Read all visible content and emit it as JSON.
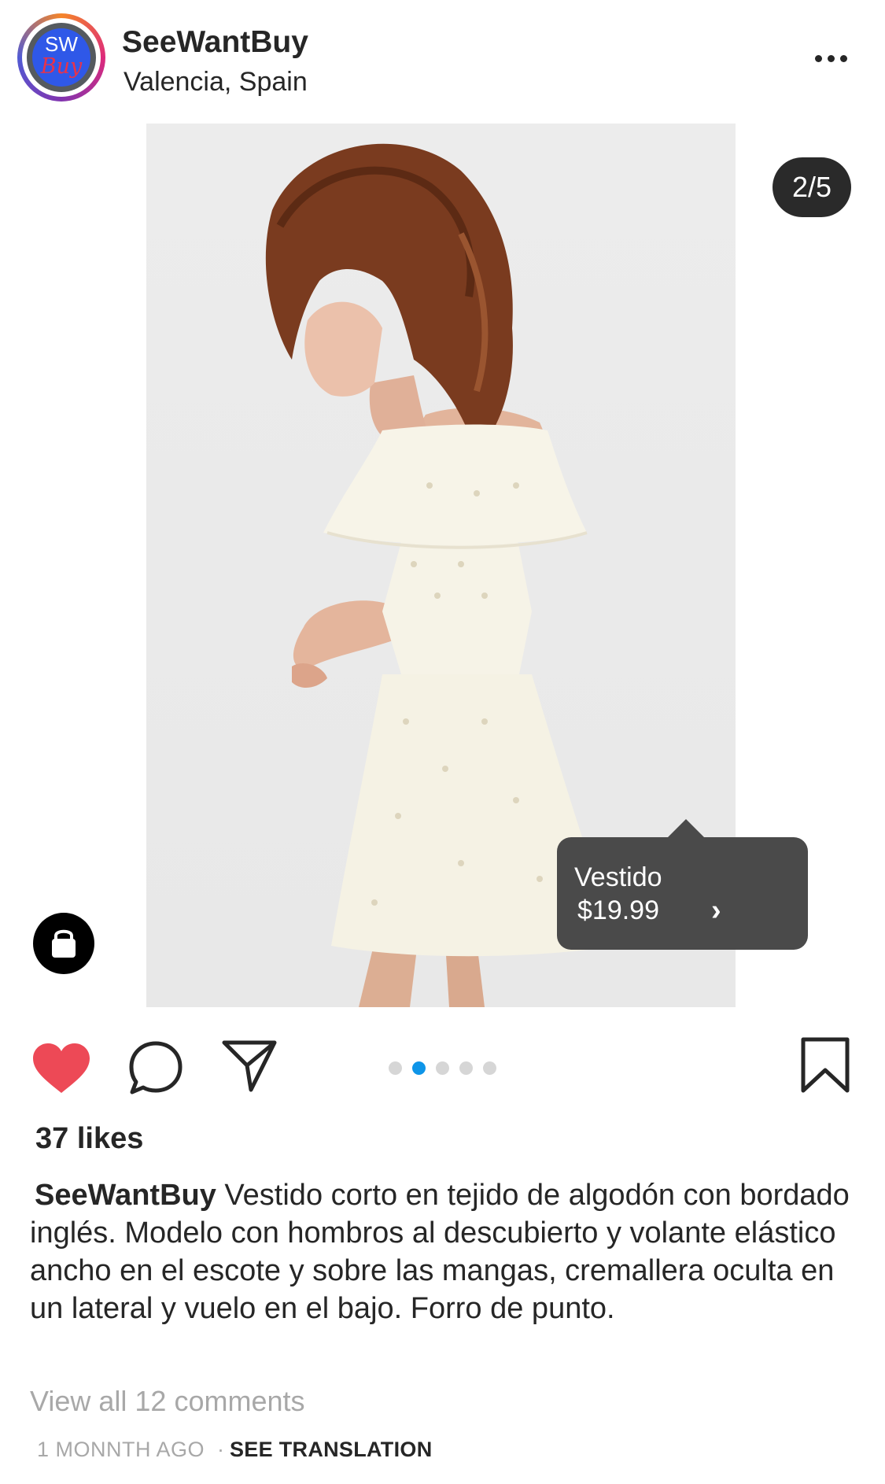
{
  "header": {
    "avatar_text_top": "SW",
    "avatar_text_bottom": "Buy",
    "username": "SeeWantBuy",
    "location": "Valencia, Spain",
    "more_icon": "more-horizontal-icon"
  },
  "post": {
    "image_counter": "2/5",
    "current_image": 2,
    "total_images": 5,
    "image_description": "photo of a model in an off-shoulder white eyelet mini dress",
    "product_tag": {
      "name": "Vestido",
      "price": "$19.99",
      "chevron": "›"
    },
    "shop_icon": "shopping-bag-icon"
  },
  "actions": {
    "like_icon": "heart-filled-icon",
    "comment_icon": "comment-bubble-icon",
    "share_icon": "paper-plane-icon",
    "save_icon": "bookmark-icon",
    "liked": true,
    "active_dot": 1,
    "dot_count": 5
  },
  "likes_text": "37 likes",
  "caption": {
    "username": "SeeWantBuy",
    "text": "Vestido corto en tejido de algodón con bordado inglés. Modelo con hombros al descubierto y volante elástico ancho en el escote y sobre las mangas, cremallera oculta en un lateral y vuelo en el bajo. Forro de punto."
  },
  "comments_link": "View all 12 comments",
  "timestamp": "1 MONNTH AGO",
  "separator": "·",
  "see_translation": "SEE TRANSLATION",
  "colors": {
    "like_red": "#ed4956",
    "active_dot": "#0e95e8",
    "inactive_dot": "#d6d6d6",
    "muted_text": "#a8a8a8",
    "tag_bg": "#4a4a4a"
  }
}
